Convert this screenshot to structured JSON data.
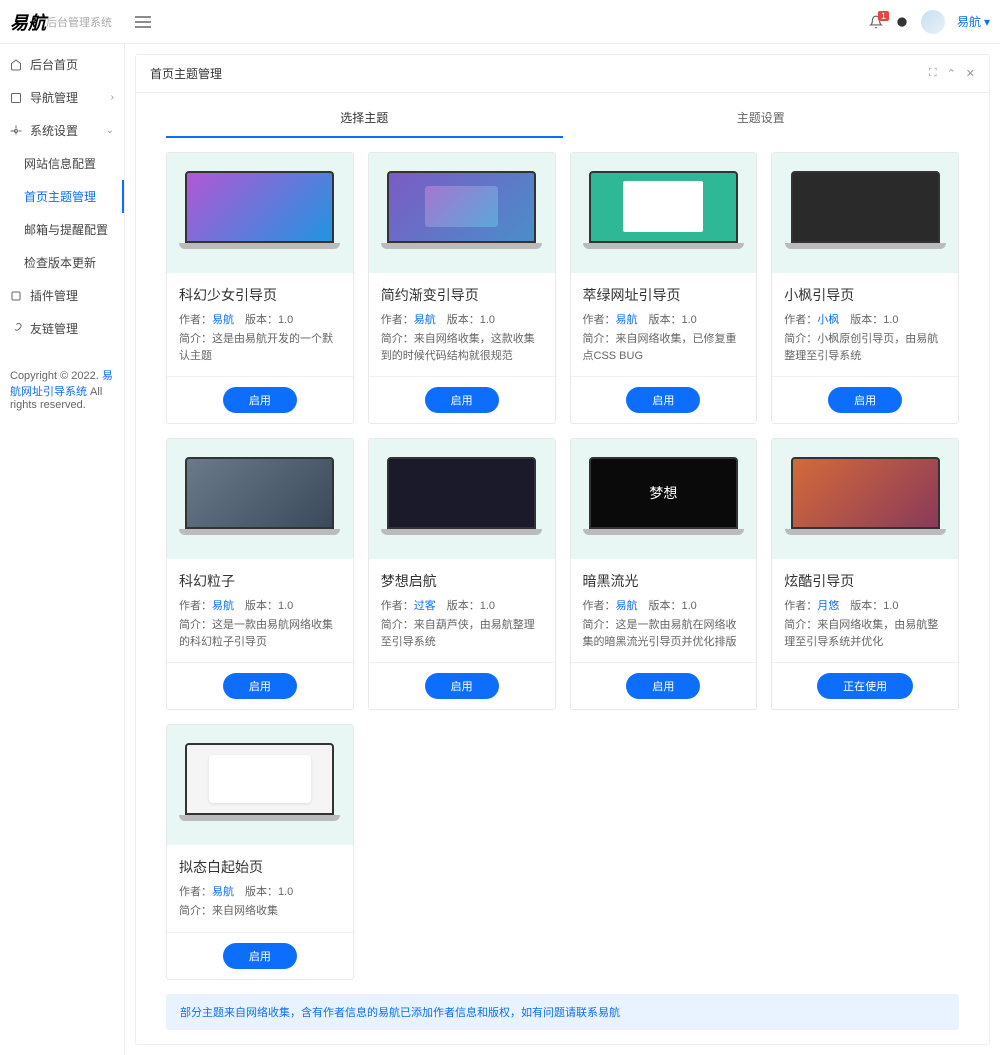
{
  "header": {
    "brand": "易航",
    "brand_sub": "后台管理系统",
    "badge": "1",
    "user": "易航"
  },
  "sidebar": {
    "items": [
      {
        "label": "后台首页"
      },
      {
        "label": "导航管理"
      },
      {
        "label": "系统设置"
      }
    ],
    "subs": [
      {
        "label": "网站信息配置"
      },
      {
        "label": "首页主题管理"
      },
      {
        "label": "邮箱与提醒配置"
      },
      {
        "label": "检查版本更新"
      }
    ],
    "extra": [
      {
        "label": "插件管理"
      },
      {
        "label": "友链管理"
      }
    ]
  },
  "copyright": {
    "prefix": "Copyright © 2022. ",
    "link": "易航网址引导系统",
    "suffix": " All rights reserved."
  },
  "panel": {
    "title": "首页主题管理"
  },
  "tabs": {
    "select": "选择主题",
    "settings": "主题设置"
  },
  "themes": [
    {
      "title": "科幻少女引导页",
      "author_label": "作者：",
      "author": "易航",
      "ver_label": "版本：",
      "ver": "1.0",
      "desc": "简介：这是由易航开发的一个默认主题",
      "btn": "启用",
      "screen": "screen-bg-1"
    },
    {
      "title": "简约渐变引导页",
      "author_label": "作者：",
      "author": "易航",
      "ver_label": "版本：",
      "ver": "1.0",
      "desc": "简介：来自网络收集，这款收集到的时候代码结构就很规范",
      "btn": "启用",
      "screen": "screen-bg-2"
    },
    {
      "title": "萃绿网址引导页",
      "author_label": "作者：",
      "author": "易航",
      "ver_label": "版本：",
      "ver": "1.0",
      "desc": "简介：来自网络收集，已修复重点CSS BUG",
      "btn": "启用",
      "screen": "screen-bg-3"
    },
    {
      "title": "小枫引导页",
      "author_label": "作者：",
      "author": "小枫",
      "ver_label": "版本：",
      "ver": "1.0",
      "desc": "简介：小枫原创引导页，由易航整理至引导系统",
      "btn": "启用",
      "screen": "screen-bg-4"
    },
    {
      "title": "科幻粒子",
      "author_label": "作者：",
      "author": "易航",
      "ver_label": "版本：",
      "ver": "1.0",
      "desc": "简介：这是一款由易航网络收集的科幻粒子引导页",
      "btn": "启用",
      "screen": "screen-bg-5"
    },
    {
      "title": "梦想启航",
      "author_label": "作者：",
      "author": "过客",
      "ver_label": "版本：",
      "ver": "1.0",
      "desc": "简介：来自葫芦侠，由易航整理至引导系统",
      "btn": "启用",
      "screen": "screen-bg-6"
    },
    {
      "title": "暗黑流光",
      "author_label": "作者：",
      "author": "易航",
      "ver_label": "版本：",
      "ver": "1.0",
      "desc": "简介：这是一款由易航在网络收集的暗黑流光引导页并优化排版",
      "btn": "启用",
      "screen": "screen-bg-7"
    },
    {
      "title": "炫酷引导页",
      "author_label": "作者：",
      "author": "月悠",
      "ver_label": "版本：",
      "ver": "1.0",
      "desc": "简介：来自网络收集，由易航整理至引导系统并优化",
      "btn": "正在使用",
      "screen": "screen-bg-8",
      "using": true
    },
    {
      "title": "拟态白起始页",
      "author_label": "作者：",
      "author": "易航",
      "ver_label": "版本：",
      "ver": "1.0",
      "desc": "简介：来自网络收集",
      "btn": "启用",
      "screen": "screen-bg-9"
    }
  ],
  "notice": "部分主题来自网络收集，含有作者信息的易航已添加作者信息和版权，如有问题请联系易航"
}
